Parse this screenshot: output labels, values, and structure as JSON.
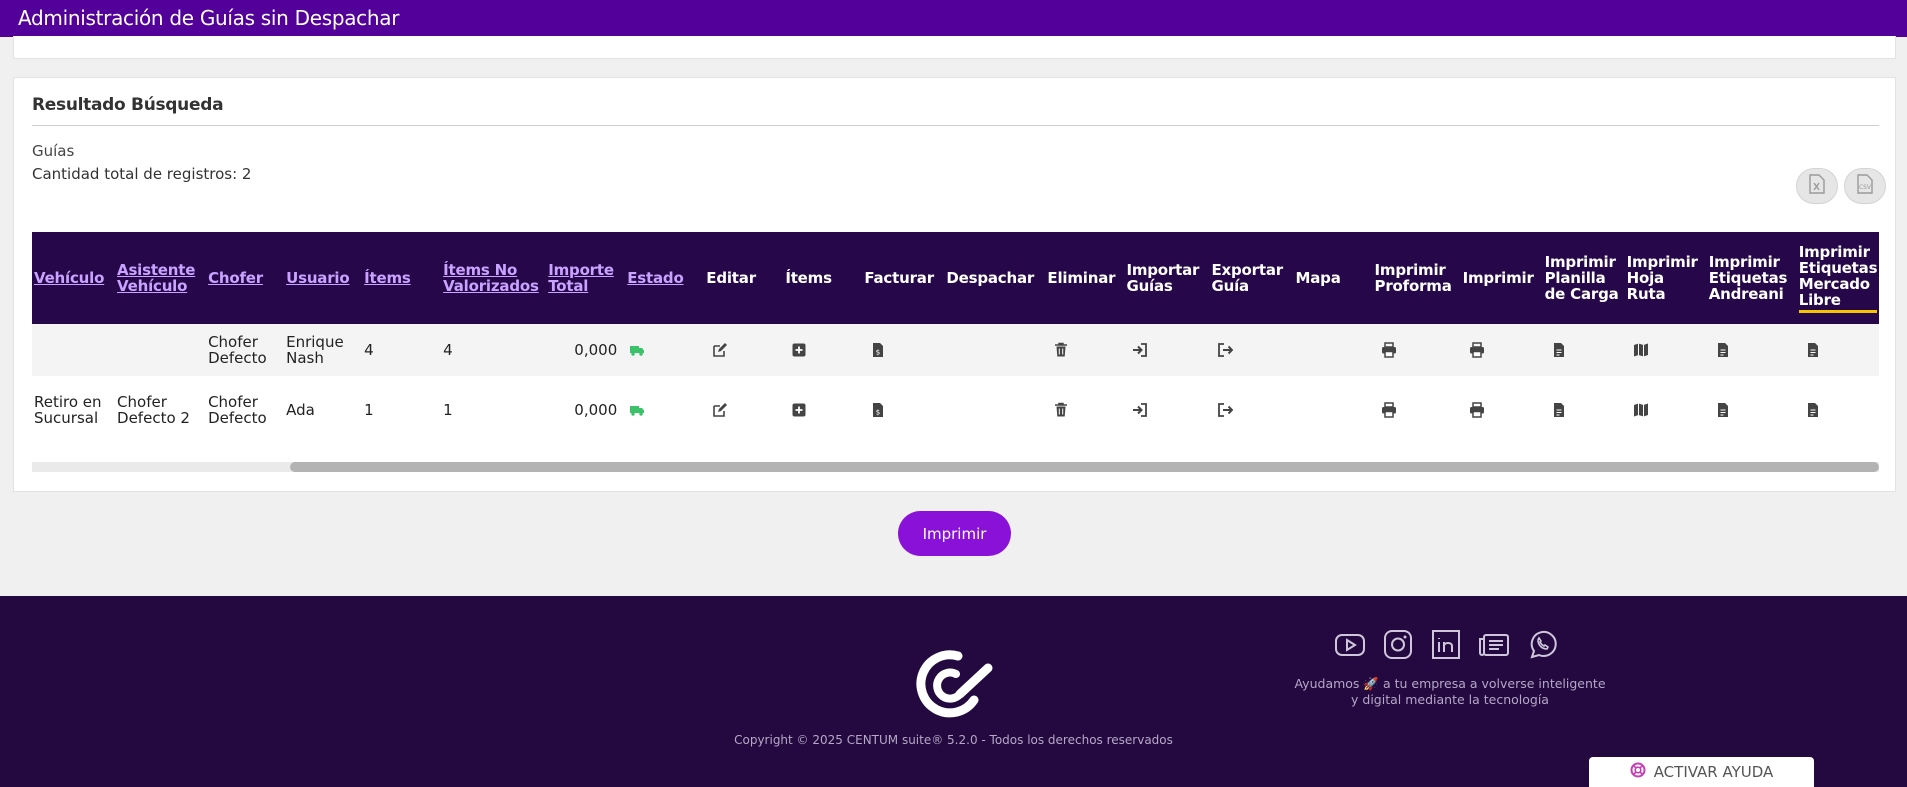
{
  "app": {
    "title": "Administración de Guías sin Despachar"
  },
  "results": {
    "title": "Resultado Búsqueda",
    "subtitle": "Guías",
    "count_label": "Cantidad total de registros: 2",
    "export_buttons": [
      {
        "icon": "excel-file-icon"
      },
      {
        "icon": "csv-file-icon"
      }
    ]
  },
  "table": {
    "columns": [
      {
        "label": "Vehículo",
        "sortable": true
      },
      {
        "label": "Asistente Vehículo",
        "sortable": true
      },
      {
        "label": "Chofer",
        "sortable": true
      },
      {
        "label": "Usuario",
        "sortable": true
      },
      {
        "label": "Ítems",
        "sortable": true
      },
      {
        "label": "Ítems No Valorizados",
        "sortable": true
      },
      {
        "label": "Importe Total",
        "sortable": true
      },
      {
        "label": "Estado",
        "sortable": true
      },
      {
        "label": "Editar",
        "sortable": false
      },
      {
        "label": "Ítems",
        "sortable": false
      },
      {
        "label": "Facturar",
        "sortable": false
      },
      {
        "label": "Despachar",
        "sortable": false
      },
      {
        "label": "Eliminar",
        "sortable": false
      },
      {
        "label": "Importar Guías",
        "sortable": false
      },
      {
        "label": "Exportar Guía",
        "sortable": false
      },
      {
        "label": "Mapa",
        "sortable": false
      },
      {
        "label": "Imprimir Proforma",
        "sortable": false
      },
      {
        "label": "Imprimir",
        "sortable": false
      },
      {
        "label": "Imprimir Planilla de Carga",
        "sortable": false
      },
      {
        "label": "Imprimir Hoja Ruta",
        "sortable": false
      },
      {
        "label": "Imprimir Etiquetas Andreani",
        "sortable": false
      },
      {
        "label": "Imprimir Etiquetas Mercado Libre",
        "sortable": false
      }
    ],
    "rows": [
      {
        "vehiculo": "",
        "asistente": "",
        "chofer": "Chofer Defecto",
        "usuario": "Enrique Nash",
        "items": "4",
        "items_no_valorizados": "4",
        "importe_total": "0,000",
        "estado_icon": "truck-icon"
      },
      {
        "vehiculo": "Retiro en Sucursal",
        "asistente": "Chofer Defecto 2",
        "chofer": "Chofer Defecto",
        "usuario": "Ada",
        "items": "1",
        "items_no_valorizados": "1",
        "importe_total": "0,000",
        "estado_icon": "truck-icon"
      }
    ]
  },
  "actions": {
    "print_label": "Imprimir"
  },
  "footer": {
    "copyright": "Copyright © 2025 CENTUM suite® 5.2.0 - Todos los derechos reservados",
    "tagline_1": "Ayudamos 🚀 a tu empresa a volverse inteligente",
    "tagline_2": "y digital mediante la tecnología",
    "socials": [
      "youtube-icon",
      "instagram-icon",
      "linkedin-icon",
      "blog-icon",
      "whatsapp-icon"
    ],
    "help_label": "ACTIVAR AYUDA"
  },
  "colors": {
    "topbar": "#520099",
    "table_header": "#26084a",
    "header_link": "#c9a3ff",
    "active_underline": "#f5c400",
    "print_button": "#8a12d8",
    "footer": "#23093f",
    "status_green": "#3cc26b"
  }
}
